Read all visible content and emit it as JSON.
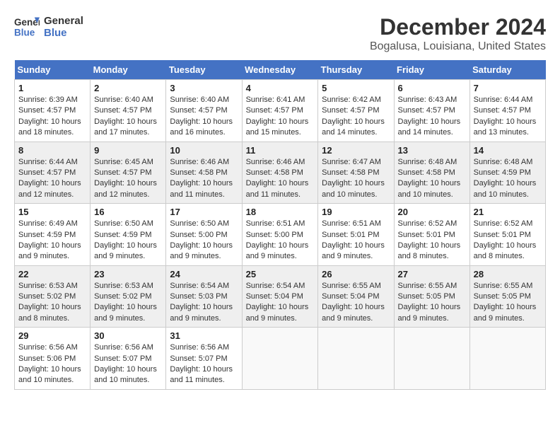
{
  "header": {
    "logo_line1": "General",
    "logo_line2": "Blue",
    "month": "December 2024",
    "location": "Bogalusa, Louisiana, United States"
  },
  "days_of_week": [
    "Sunday",
    "Monday",
    "Tuesday",
    "Wednesday",
    "Thursday",
    "Friday",
    "Saturday"
  ],
  "weeks": [
    [
      {
        "day": "1",
        "info": "Sunrise: 6:39 AM\nSunset: 4:57 PM\nDaylight: 10 hours and 18 minutes."
      },
      {
        "day": "2",
        "info": "Sunrise: 6:40 AM\nSunset: 4:57 PM\nDaylight: 10 hours and 17 minutes."
      },
      {
        "day": "3",
        "info": "Sunrise: 6:40 AM\nSunset: 4:57 PM\nDaylight: 10 hours and 16 minutes."
      },
      {
        "day": "4",
        "info": "Sunrise: 6:41 AM\nSunset: 4:57 PM\nDaylight: 10 hours and 15 minutes."
      },
      {
        "day": "5",
        "info": "Sunrise: 6:42 AM\nSunset: 4:57 PM\nDaylight: 10 hours and 14 minutes."
      },
      {
        "day": "6",
        "info": "Sunrise: 6:43 AM\nSunset: 4:57 PM\nDaylight: 10 hours and 14 minutes."
      },
      {
        "day": "7",
        "info": "Sunrise: 6:44 AM\nSunset: 4:57 PM\nDaylight: 10 hours and 13 minutes."
      }
    ],
    [
      {
        "day": "8",
        "info": "Sunrise: 6:44 AM\nSunset: 4:57 PM\nDaylight: 10 hours and 12 minutes."
      },
      {
        "day": "9",
        "info": "Sunrise: 6:45 AM\nSunset: 4:57 PM\nDaylight: 10 hours and 12 minutes."
      },
      {
        "day": "10",
        "info": "Sunrise: 6:46 AM\nSunset: 4:58 PM\nDaylight: 10 hours and 11 minutes."
      },
      {
        "day": "11",
        "info": "Sunrise: 6:46 AM\nSunset: 4:58 PM\nDaylight: 10 hours and 11 minutes."
      },
      {
        "day": "12",
        "info": "Sunrise: 6:47 AM\nSunset: 4:58 PM\nDaylight: 10 hours and 10 minutes."
      },
      {
        "day": "13",
        "info": "Sunrise: 6:48 AM\nSunset: 4:58 PM\nDaylight: 10 hours and 10 minutes."
      },
      {
        "day": "14",
        "info": "Sunrise: 6:48 AM\nSunset: 4:59 PM\nDaylight: 10 hours and 10 minutes."
      }
    ],
    [
      {
        "day": "15",
        "info": "Sunrise: 6:49 AM\nSunset: 4:59 PM\nDaylight: 10 hours and 9 minutes."
      },
      {
        "day": "16",
        "info": "Sunrise: 6:50 AM\nSunset: 4:59 PM\nDaylight: 10 hours and 9 minutes."
      },
      {
        "day": "17",
        "info": "Sunrise: 6:50 AM\nSunset: 5:00 PM\nDaylight: 10 hours and 9 minutes."
      },
      {
        "day": "18",
        "info": "Sunrise: 6:51 AM\nSunset: 5:00 PM\nDaylight: 10 hours and 9 minutes."
      },
      {
        "day": "19",
        "info": "Sunrise: 6:51 AM\nSunset: 5:01 PM\nDaylight: 10 hours and 9 minutes."
      },
      {
        "day": "20",
        "info": "Sunrise: 6:52 AM\nSunset: 5:01 PM\nDaylight: 10 hours and 8 minutes."
      },
      {
        "day": "21",
        "info": "Sunrise: 6:52 AM\nSunset: 5:01 PM\nDaylight: 10 hours and 8 minutes."
      }
    ],
    [
      {
        "day": "22",
        "info": "Sunrise: 6:53 AM\nSunset: 5:02 PM\nDaylight: 10 hours and 8 minutes."
      },
      {
        "day": "23",
        "info": "Sunrise: 6:53 AM\nSunset: 5:02 PM\nDaylight: 10 hours and 9 minutes."
      },
      {
        "day": "24",
        "info": "Sunrise: 6:54 AM\nSunset: 5:03 PM\nDaylight: 10 hours and 9 minutes."
      },
      {
        "day": "25",
        "info": "Sunrise: 6:54 AM\nSunset: 5:04 PM\nDaylight: 10 hours and 9 minutes."
      },
      {
        "day": "26",
        "info": "Sunrise: 6:55 AM\nSunset: 5:04 PM\nDaylight: 10 hours and 9 minutes."
      },
      {
        "day": "27",
        "info": "Sunrise: 6:55 AM\nSunset: 5:05 PM\nDaylight: 10 hours and 9 minutes."
      },
      {
        "day": "28",
        "info": "Sunrise: 6:55 AM\nSunset: 5:05 PM\nDaylight: 10 hours and 9 minutes."
      }
    ],
    [
      {
        "day": "29",
        "info": "Sunrise: 6:56 AM\nSunset: 5:06 PM\nDaylight: 10 hours and 10 minutes."
      },
      {
        "day": "30",
        "info": "Sunrise: 6:56 AM\nSunset: 5:07 PM\nDaylight: 10 hours and 10 minutes."
      },
      {
        "day": "31",
        "info": "Sunrise: 6:56 AM\nSunset: 5:07 PM\nDaylight: 10 hours and 11 minutes."
      },
      {
        "day": "",
        "info": ""
      },
      {
        "day": "",
        "info": ""
      },
      {
        "day": "",
        "info": ""
      },
      {
        "day": "",
        "info": ""
      }
    ]
  ]
}
